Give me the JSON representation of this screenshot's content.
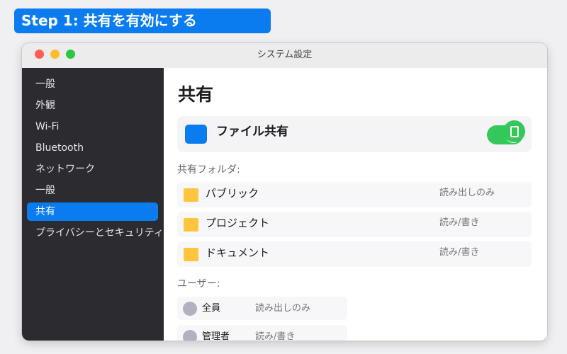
{
  "banner": {
    "text": "Step 1: 共有を有効にする"
  },
  "window": {
    "title": "システム設定"
  },
  "sidebar": {
    "items": [
      {
        "label": "一般"
      },
      {
        "label": "外観"
      },
      {
        "label": "Wi-Fi"
      },
      {
        "label": "Bluetooth"
      },
      {
        "label": "ネットワーク"
      },
      {
        "label": "一般"
      },
      {
        "label": "共有",
        "selected": true
      },
      {
        "label": "プライバシーとセキュリティ"
      }
    ]
  },
  "main": {
    "title": "共有",
    "file_sharing": {
      "label": "ファイル共有",
      "enabled": true
    },
    "folders_label": "共有フォルダ:",
    "folders": [
      {
        "name": "パブリック",
        "permission": "読み出しのみ"
      },
      {
        "name": "プロジェクト",
        "permission": "読み/書き"
      },
      {
        "name": "ドキュメント",
        "permission": "読み/書き"
      }
    ],
    "users_label": "ユーザー:",
    "users": [
      {
        "name": "全員",
        "permission": "読み出しのみ"
      },
      {
        "name": "管理者",
        "permission": "読み/書き"
      }
    ]
  },
  "colors": {
    "accent": "#0a7cf0",
    "toggle_on": "#34c759",
    "folder": "#ffc53d",
    "sidebar_bg": "#2b2b30"
  },
  "icons": {
    "file_sharing": "file-sharing-icon",
    "device": "device-icon",
    "folder": "folder-icon",
    "user": "user-avatar-icon"
  }
}
